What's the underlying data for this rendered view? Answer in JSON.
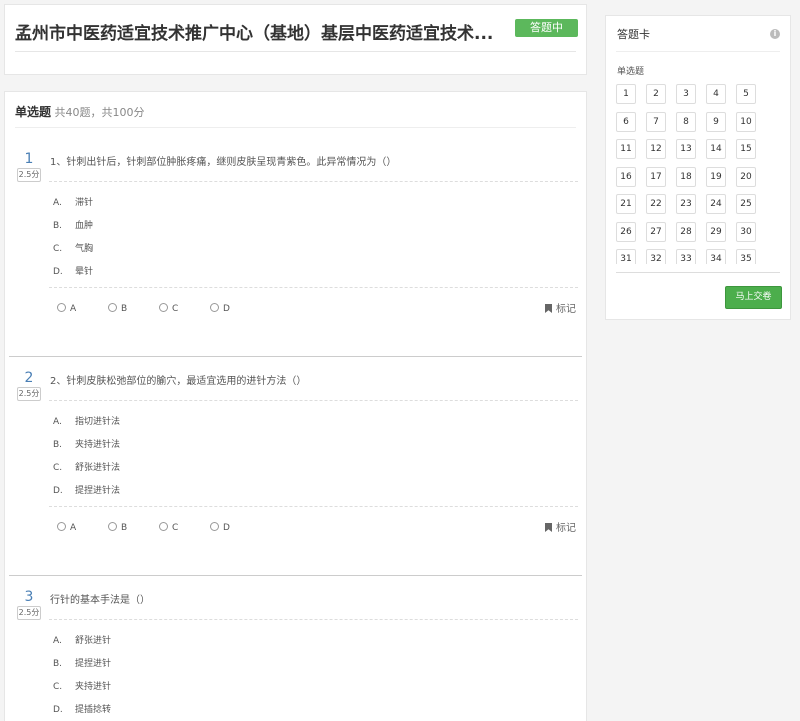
{
  "header": {
    "title": "孟州市中医药适宜技术推广中心（基地）基层中医药适宜技术...",
    "status": "答题中"
  },
  "section": {
    "name": "单选题",
    "summary": "共40题，共100分"
  },
  "questions": [
    {
      "number": "1",
      "score": "2.5分",
      "text": "1、针刺出针后，针刺部位肿胀疼痛，继则皮肤呈现青紫色。此异常情况为（）",
      "options": [
        {
          "letter": "A.",
          "text": "滞针"
        },
        {
          "letter": "B.",
          "text": "血肿"
        },
        {
          "letter": "C.",
          "text": "气胸"
        },
        {
          "letter": "D.",
          "text": "晕针"
        }
      ],
      "choices": [
        "A",
        "B",
        "C",
        "D"
      ],
      "mark_label": "标记"
    },
    {
      "number": "2",
      "score": "2.5分",
      "text": "2、针刺皮肤松弛部位的腧穴，最适宜选用的进针方法（）",
      "options": [
        {
          "letter": "A.",
          "text": "指切进针法"
        },
        {
          "letter": "B.",
          "text": "夹持进针法"
        },
        {
          "letter": "C.",
          "text": "舒张进针法"
        },
        {
          "letter": "D.",
          "text": "提捏进针法"
        }
      ],
      "choices": [
        "A",
        "B",
        "C",
        "D"
      ],
      "mark_label": "标记"
    },
    {
      "number": "3",
      "score": "2.5分",
      "text": "行针的基本手法是（）",
      "options": [
        {
          "letter": "A.",
          "text": "舒张进针"
        },
        {
          "letter": "B.",
          "text": "提捏进针"
        },
        {
          "letter": "C.",
          "text": "夹持进针"
        },
        {
          "letter": "D.",
          "text": "提插捻转"
        }
      ]
    }
  ],
  "answer_card": {
    "title": "答题卡",
    "section_label": "单选题",
    "numbers": [
      "1",
      "2",
      "3",
      "4",
      "5",
      "6",
      "7",
      "8",
      "9",
      "10",
      "11",
      "12",
      "13",
      "14",
      "15",
      "16",
      "17",
      "18",
      "19",
      "20",
      "21",
      "22",
      "23",
      "24",
      "25",
      "26",
      "27",
      "28",
      "29",
      "30",
      "31",
      "32",
      "33",
      "34",
      "35"
    ],
    "submit_label": "马上交卷"
  }
}
